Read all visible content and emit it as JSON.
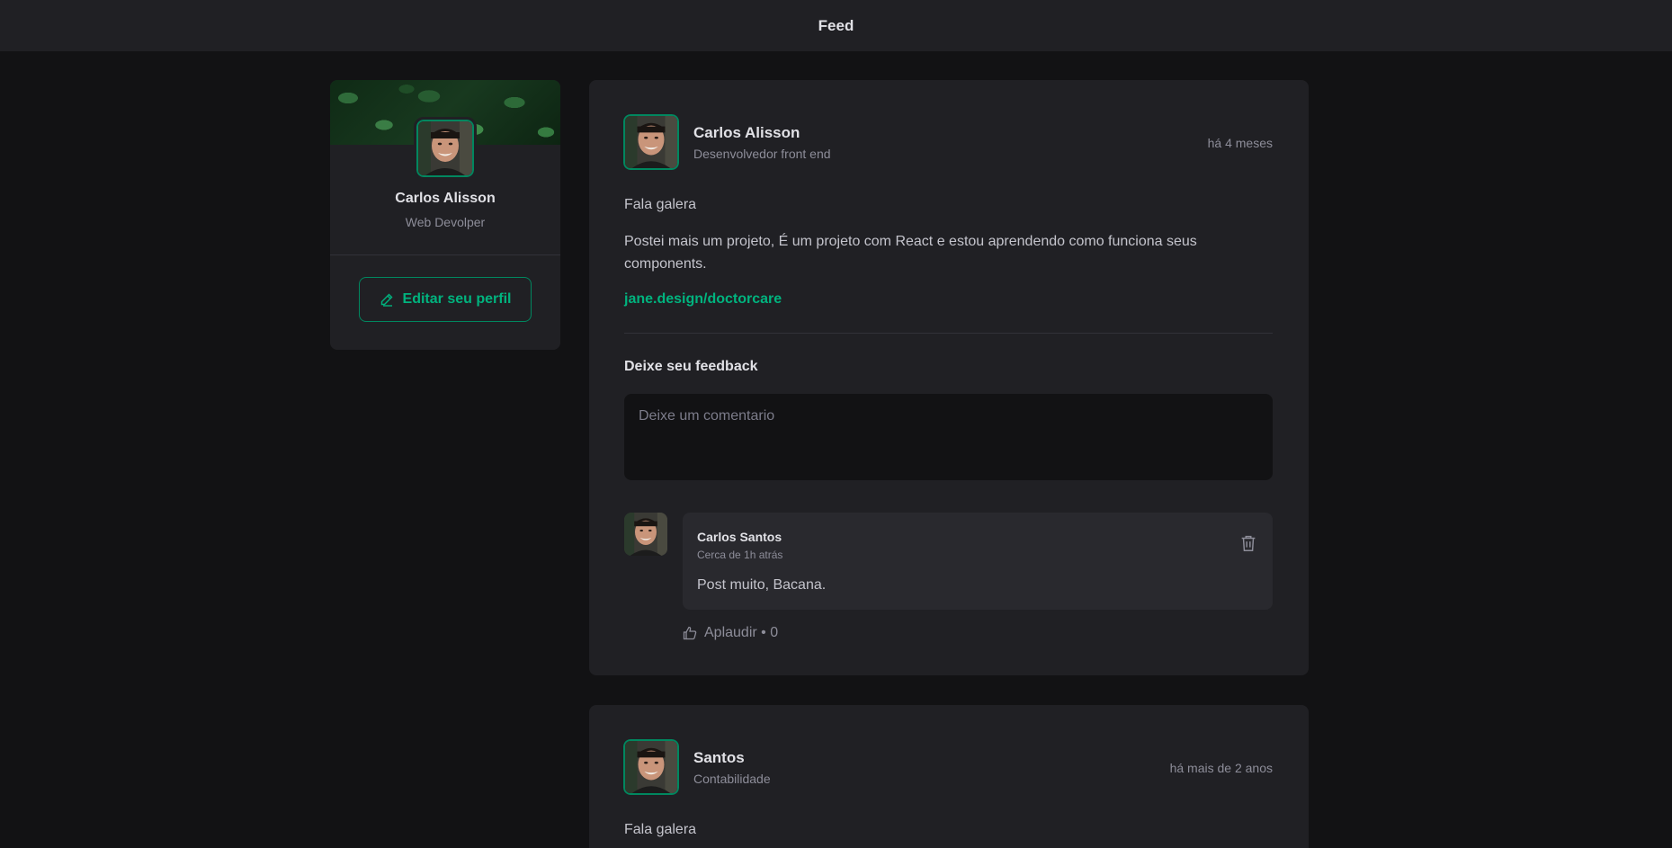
{
  "header": {
    "title": "Feed"
  },
  "sidebar": {
    "name": "Carlos Alisson",
    "role": "Web Devolper",
    "edit_button": "Editar seu perfil"
  },
  "posts": [
    {
      "author": "Carlos Alisson",
      "role": "Desenvolvedor front end",
      "time": "há 4 meses",
      "paragraphs": [
        "Fala galera",
        "Postei mais um projeto, É um projeto com React e estou aprendendo como funciona seus components."
      ],
      "link": "jane.design/doctorcare",
      "feedback_title": "Deixe seu feedback",
      "comment_placeholder": "Deixe um comentario",
      "comments": [
        {
          "author": "Carlos Santos",
          "time": "Cerca de 1h atrás",
          "text": "Post muito, Bacana.",
          "applaud_label": "Aplaudir • 0"
        }
      ]
    },
    {
      "author": "Santos",
      "role": "Contabilidade",
      "time": "há mais de 2 anos",
      "paragraphs": [
        "Fala galera"
      ]
    }
  ],
  "icons": {
    "edit": "pencil-icon",
    "delete": "trash-icon",
    "applaud": "thumbs-up-icon"
  },
  "colors": {
    "accent": "#00875f",
    "accent_light": "#00b37e",
    "background": "#121214",
    "surface": "#202024"
  }
}
